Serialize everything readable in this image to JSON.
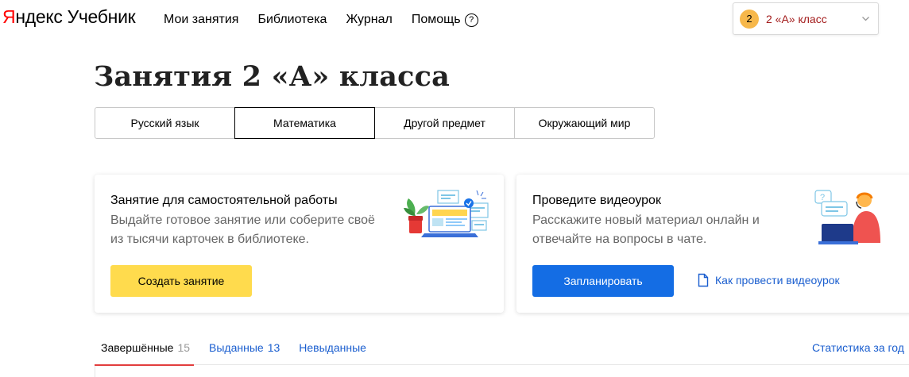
{
  "header": {
    "logo_ya": "Я",
    "logo_rest": "ндекс",
    "logo_product": "Учебник",
    "nav": [
      {
        "label": "Мои занятия"
      },
      {
        "label": "Библиотека"
      },
      {
        "label": "Журнал"
      },
      {
        "label": "Помощь"
      }
    ],
    "help_glyph": "?",
    "class_selector": {
      "badge": "2",
      "label": "2 «А» класс"
    }
  },
  "page": {
    "title": "Занятия 2 «А» класса"
  },
  "subject_tabs": [
    {
      "label": "Русский язык"
    },
    {
      "label": "Математика"
    },
    {
      "label": "Другой предмет"
    },
    {
      "label": "Окружающий мир"
    }
  ],
  "cards": {
    "self_work": {
      "title": "Занятие для самостоятельной работы",
      "text": "Выдайте готовое занятие или соберите своё из тысячи карточек в библиотеке.",
      "button": "Создать занятие"
    },
    "video": {
      "title": "Проведите видеоурок",
      "text": "Расскажите новый материал онлайн и отвечайте на вопросы в чате.",
      "button": "Запланировать",
      "link": "Как провести видеоурок"
    }
  },
  "lesson_tabs": [
    {
      "label": "Завершённые",
      "count": "15"
    },
    {
      "label": "Выданные",
      "count": "13"
    },
    {
      "label": "Невыданные",
      "count": ""
    }
  ],
  "stats_link": "Статистика за год",
  "colors": {
    "brand_red": "#ff0000",
    "accent_yellow": "#ffdb4d",
    "primary_blue": "#146de4",
    "link_blue": "#1a5ecf"
  },
  "icons": [
    "help-icon",
    "chevron-down-icon",
    "document-icon",
    "laptop-illustration",
    "teacher-illustration"
  ]
}
